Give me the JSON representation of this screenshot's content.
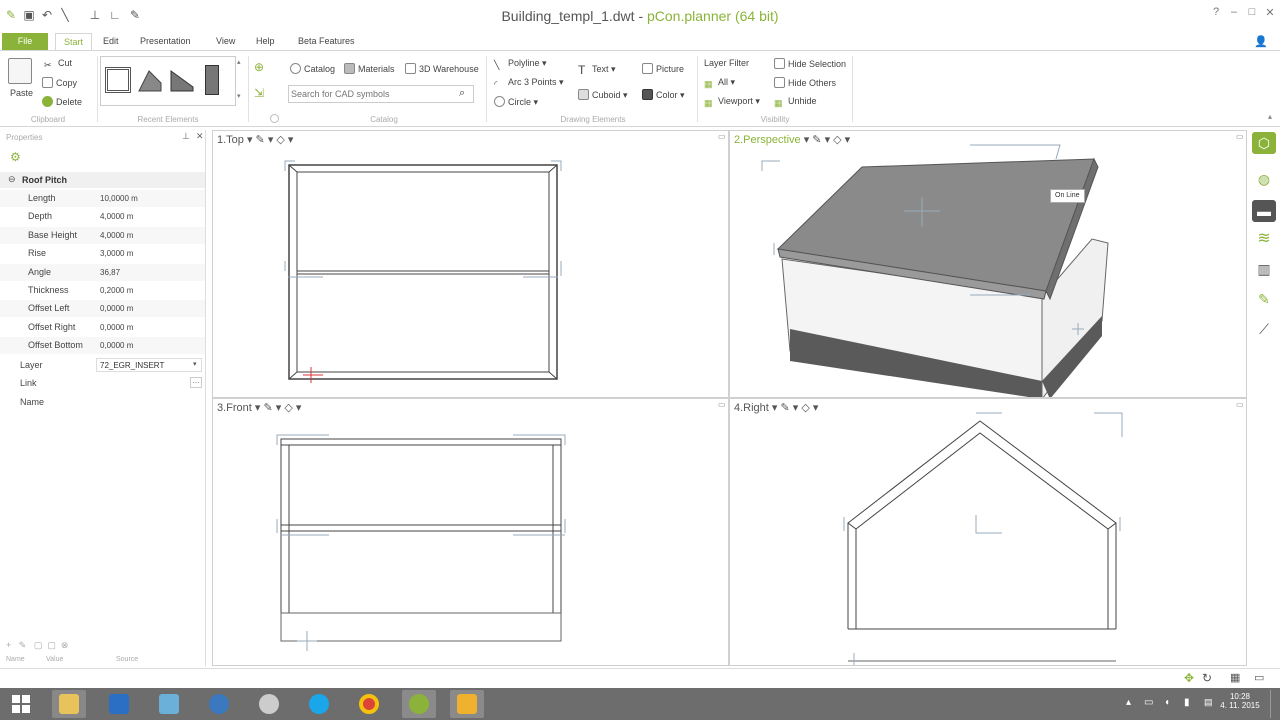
{
  "window": {
    "file_name": "Building_templ_1.dwt - ",
    "app_name": "pCon.planner (64 bit)",
    "help_glyph": "?",
    "min_glyph": "–",
    "max_glyph": "□",
    "close_glyph": "✕"
  },
  "menu": {
    "file": "File",
    "start": "Start",
    "edit": "Edit",
    "presentation": "Presentation",
    "view": "View",
    "help": "Help",
    "beta": "Beta Features"
  },
  "ribbon": {
    "clipboard": {
      "paste": "Paste",
      "cut": "Cut",
      "copy": "Copy",
      "delete": "Delete",
      "label": "Clipboard"
    },
    "recent_label": "Recent Elements",
    "catalog": {
      "catalog": "Catalog",
      "materials": "Materials",
      "warehouse": "3D Warehouse",
      "search_placeholder": "Search for CAD symbols",
      "label": "Catalog"
    },
    "drawing": {
      "polyline": "Polyline",
      "arc": "Arc 3 Points",
      "circle": "Circle",
      "text": "Text",
      "picture": "Picture",
      "cuboid": "Cuboid",
      "color": "Color",
      "label": "Drawing Elements"
    },
    "visibility": {
      "layer_filter": "Layer Filter",
      "all": "All",
      "viewport": "Viewport",
      "hide_selection": "Hide Selection",
      "hide_others": "Hide Others",
      "unhide": "Unhide",
      "label": "Visibility"
    }
  },
  "props": {
    "header": "Properties",
    "section": "Roof Pitch",
    "rows": [
      {
        "label": "Length",
        "value": "10,0000 m"
      },
      {
        "label": "Depth",
        "value": "4,0000 m"
      },
      {
        "label": "Base Height",
        "value": "4,0000 m"
      },
      {
        "label": "Rise",
        "value": "3,0000 m"
      },
      {
        "label": "Angle",
        "value": "36,87"
      },
      {
        "label": "Thickness",
        "value": "0,2000 m"
      },
      {
        "label": "Offset Left",
        "value": "0,0000 m"
      },
      {
        "label": "Offset Right",
        "value": "0,0000 m"
      },
      {
        "label": "Offset Bottom",
        "value": "0,0000 m"
      }
    ],
    "layer_label": "Layer",
    "layer_value": "72_EGR_INSERT",
    "link_label": "Link",
    "name_label": "Name",
    "footer_cols": [
      "Name",
      "Value",
      "Source"
    ]
  },
  "viewports": {
    "top": "1.Top",
    "perspective": "2.Perspective",
    "front": "3.Front",
    "right": "4.Right",
    "tooltip": "On Line"
  },
  "taskbar": {
    "time": "10:28",
    "date": "4. 11. 2015"
  },
  "colors": {
    "accent": "#8bb33a",
    "roof": "#8a8a8a",
    "wall": "#f4f4f4",
    "plinth": "#5a5a5a"
  }
}
